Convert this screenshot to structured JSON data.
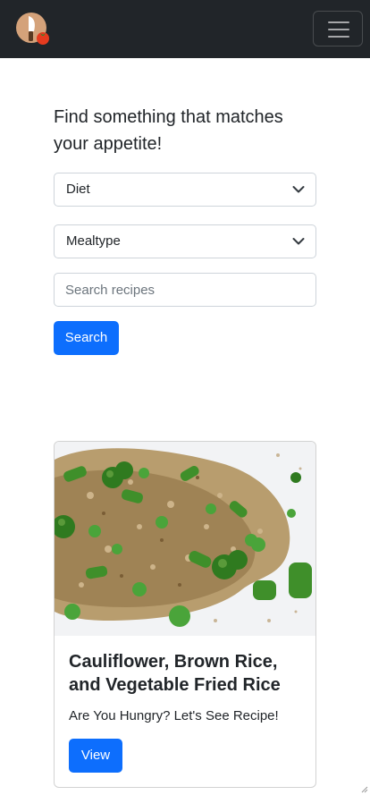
{
  "navbar": {
    "logo_icon": "chef-knife-tomato-logo-icon",
    "menu_icon": "hamburger-menu-icon",
    "background": "#212529"
  },
  "search_form": {
    "headline": "Find something that matches your appetite!",
    "diet_select": {
      "value": "Diet"
    },
    "mealtype_select": {
      "value": "Mealtype"
    },
    "search_input": {
      "placeholder": "Search recipes",
      "value": ""
    },
    "search_button": "Search"
  },
  "recipe_card": {
    "image_icon": "fried-rice-photo",
    "title": "Cauliflower, Brown Rice, and Vegetable Fried Rice",
    "text": "Are You Hungry? Let's See Recipe!",
    "button": "View"
  },
  "colors": {
    "primary": "#0d6efd",
    "border": "#ced4da",
    "text": "#212529",
    "placeholder": "#6c757d"
  }
}
